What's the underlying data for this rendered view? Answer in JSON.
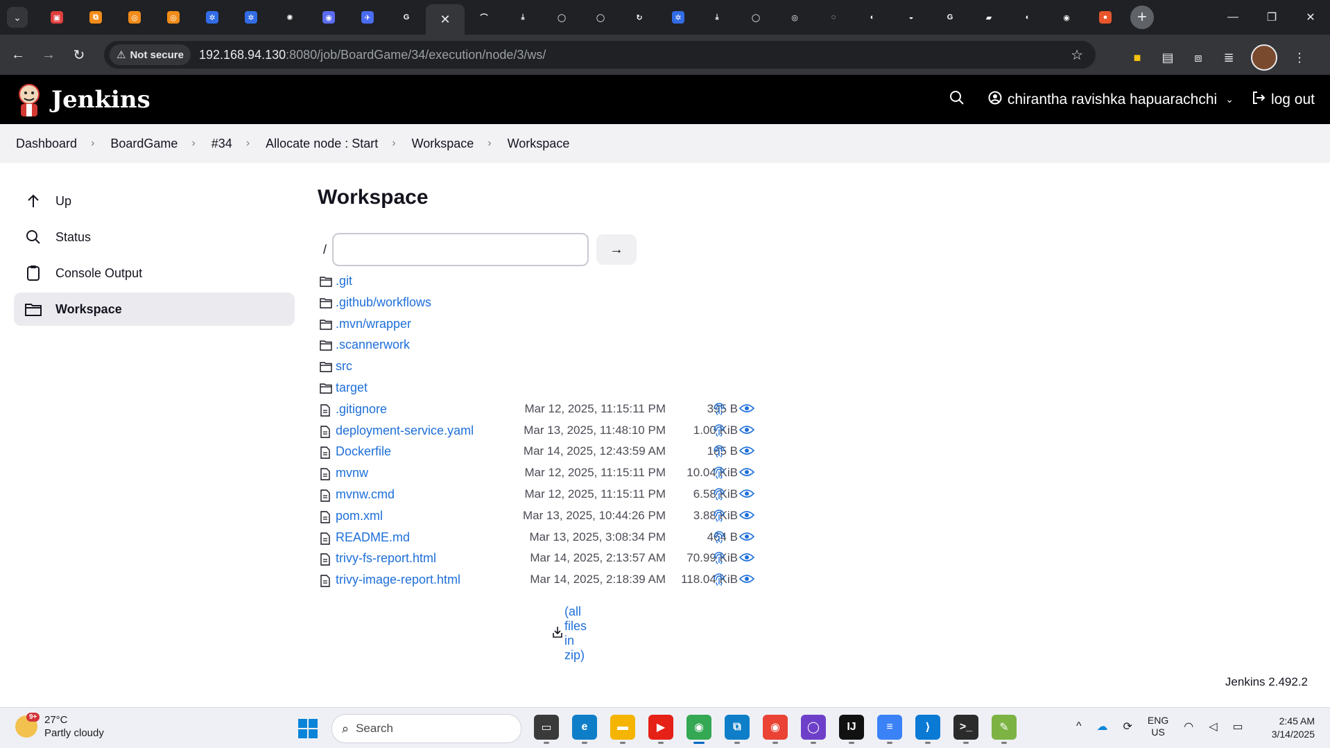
{
  "browser": {
    "tabs": [
      {
        "icon": "jenkins-red-icon",
        "color": "#e03e3e",
        "glyph": "▣"
      },
      {
        "icon": "orange-app-icon",
        "color": "#f28c1a",
        "glyph": "⧉"
      },
      {
        "icon": "orange-app-icon",
        "color": "#f28c1a",
        "glyph": "◎"
      },
      {
        "icon": "orange-app-icon",
        "color": "#f28c1a",
        "glyph": "◎"
      },
      {
        "icon": "kubernetes-icon",
        "color": "#326ce5",
        "glyph": "✲"
      },
      {
        "icon": "kubernetes-icon",
        "color": "#326ce5",
        "glyph": "✲"
      },
      {
        "icon": "openai-icon",
        "color": "#202124",
        "glyph": "✺"
      },
      {
        "icon": "copilot-icon",
        "color": "#5b6cf0",
        "glyph": "◉"
      },
      {
        "icon": "bird-icon",
        "color": "#4a6cf0",
        "glyph": "✈"
      },
      {
        "icon": "google-icon",
        "color": "#202124",
        "glyph": "G"
      },
      {
        "icon": "close-icon",
        "color": "#35363a",
        "glyph": "✕",
        "active": true
      },
      {
        "icon": "wave-icon",
        "color": "#202124",
        "glyph": "⌒"
      },
      {
        "icon": "download-green-icon",
        "color": "#202124",
        "glyph": "⤓"
      },
      {
        "icon": "github-icon",
        "color": "#202124",
        "glyph": "◯"
      },
      {
        "icon": "github-icon",
        "color": "#202124",
        "glyph": "◯"
      },
      {
        "icon": "refresh-icon",
        "color": "#202124",
        "glyph": "↻"
      },
      {
        "icon": "kubernetes-icon",
        "color": "#326ce5",
        "glyph": "✲"
      },
      {
        "icon": "download-green-icon",
        "color": "#202124",
        "glyph": "⤓"
      },
      {
        "icon": "github-icon",
        "color": "#202124",
        "glyph": "◯"
      },
      {
        "icon": "circle-logo-icon",
        "color": "#202124",
        "glyph": "◎"
      },
      {
        "icon": "circle-logo-icon",
        "color": "#202124",
        "glyph": "◌"
      },
      {
        "icon": "globe-icon",
        "color": "#202124",
        "glyph": "◐"
      },
      {
        "icon": "blue-circle-icon",
        "color": "#202124",
        "glyph": "◒"
      },
      {
        "icon": "google-icon",
        "color": "#202124",
        "glyph": "G"
      },
      {
        "icon": "notebook-icon",
        "color": "#202124",
        "glyph": "▰"
      },
      {
        "icon": "globe-icon",
        "color": "#202124",
        "glyph": "◐"
      },
      {
        "icon": "chrome-icon",
        "color": "#202124",
        "glyph": "◉"
      },
      {
        "icon": "red-orange-icon",
        "color": "#e8552b",
        "glyph": "●"
      }
    ],
    "new_tab_label": "+",
    "nav": {
      "back": "←",
      "forward": "→",
      "reload": "↻"
    },
    "security_label": "Not secure",
    "url_host": "192.168.94.130",
    "url_rest": ":8080/job/BoardGame/34/execution/node/3/ws/",
    "window_controls": {
      "minimize": "—",
      "restore": "❐",
      "close": "✕"
    }
  },
  "jenkins": {
    "brand": "Jenkins",
    "user_name": "chirantha ravishka hapuarachchi",
    "logout_label": "log out",
    "version": "Jenkins 2.492.2"
  },
  "breadcrumbs": [
    "Dashboard",
    "BoardGame",
    "#34",
    "Allocate node : Start",
    "Workspace",
    "Workspace"
  ],
  "sidebar": {
    "items": [
      {
        "label": "Up",
        "icon": "arrow-up-icon"
      },
      {
        "label": "Status",
        "icon": "search-icon"
      },
      {
        "label": "Console Output",
        "icon": "clipboard-icon"
      },
      {
        "label": "Workspace",
        "icon": "folder-icon",
        "active": true
      }
    ]
  },
  "workspace": {
    "title": "Workspace",
    "path_root": "/",
    "path_input_value": "",
    "path_go_label": "→",
    "folders": [
      ".git",
      ".github/workflows",
      ".mvn/wrapper",
      ".scannerwork",
      "src",
      "target"
    ],
    "files": [
      {
        "name": ".gitignore",
        "date": "Mar 12, 2025, 11:15:11 PM",
        "size": "395 B"
      },
      {
        "name": "deployment-service.yaml",
        "date": "Mar 13, 2025, 11:48:10 PM",
        "size": "1.00 KiB"
      },
      {
        "name": "Dockerfile",
        "date": "Mar 14, 2025, 12:43:59 AM",
        "size": "185 B"
      },
      {
        "name": "mvnw",
        "date": "Mar 12, 2025, 11:15:11 PM",
        "size": "10.04 KiB"
      },
      {
        "name": "mvnw.cmd",
        "date": "Mar 12, 2025, 11:15:11 PM",
        "size": "6.58 KiB"
      },
      {
        "name": "pom.xml",
        "date": "Mar 13, 2025, 10:44:26 PM",
        "size": "3.88 KiB"
      },
      {
        "name": "README.md",
        "date": "Mar 13, 2025, 3:08:34 PM",
        "size": "464 B"
      },
      {
        "name": "trivy-fs-report.html",
        "date": "Mar 14, 2025, 2:13:57 AM",
        "size": "70.99 KiB"
      },
      {
        "name": "trivy-image-report.html",
        "date": "Mar 14, 2025, 2:18:39 AM",
        "size": "118.04 KiB"
      }
    ],
    "zip_label": "(all files in zip)"
  },
  "taskbar": {
    "weather_temp": "27°C",
    "weather_desc": "Partly cloudy",
    "weather_badge": "9+",
    "search_placeholder": "Search",
    "apps": [
      {
        "icon": "task-view-icon",
        "color": "#3a3a3a",
        "glyph": "▭"
      },
      {
        "icon": "edge-icon",
        "color": "#0f7ec8",
        "glyph": "e"
      },
      {
        "icon": "file-explorer-icon",
        "color": "#f4b400",
        "glyph": "▬"
      },
      {
        "icon": "youtube-icon",
        "color": "#e62117",
        "glyph": "▶"
      },
      {
        "icon": "chrome-icon",
        "color": "#34a853",
        "glyph": "◉",
        "focused": true
      },
      {
        "icon": "windows-app-icon",
        "color": "#0f7ec8",
        "glyph": "⧉"
      },
      {
        "icon": "chrome-icon",
        "color": "#ea4335",
        "glyph": "◉"
      },
      {
        "icon": "github-desktop-icon",
        "color": "#6e40c9",
        "glyph": "◯"
      },
      {
        "icon": "intellij-icon",
        "color": "#111111",
        "glyph": "IJ"
      },
      {
        "icon": "notepad-icon",
        "color": "#3b82f6",
        "glyph": "≡"
      },
      {
        "icon": "vscode-icon",
        "color": "#0a7ad4",
        "glyph": "⟩"
      },
      {
        "icon": "terminal-icon",
        "color": "#2b2b2b",
        "glyph": ">_"
      },
      {
        "icon": "notepadpp-icon",
        "color": "#7cb342",
        "glyph": "✎"
      }
    ],
    "tray": {
      "chevron": "^",
      "lang_top": "ENG",
      "lang_bottom": "US"
    },
    "time": "2:45 AM",
    "date": "3/14/2025"
  },
  "colors": {
    "link": "#1e6fd9",
    "header_bg": "#000000",
    "breadcrumb_bg": "#f2f2f5",
    "active_item_bg": "#ebebef"
  }
}
